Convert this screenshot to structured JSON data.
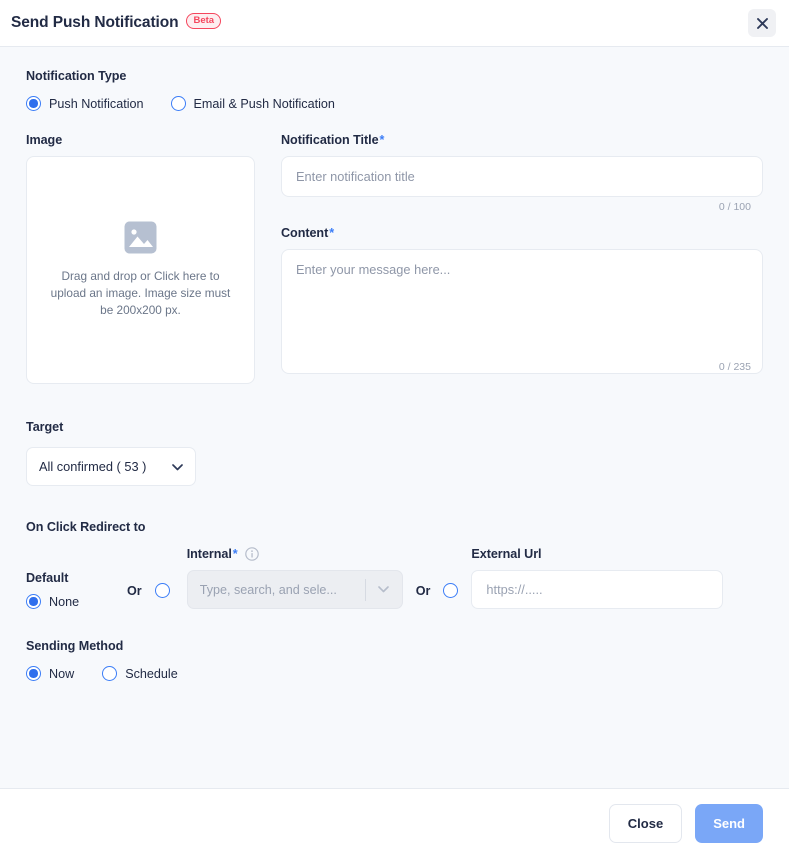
{
  "header": {
    "title": "Send Push Notification",
    "badge": "Beta",
    "close_icon": "close-icon"
  },
  "notification_type": {
    "label": "Notification Type",
    "options": [
      {
        "label": "Push Notification",
        "checked": true
      },
      {
        "label": "Email & Push Notification",
        "checked": false
      }
    ]
  },
  "image": {
    "label": "Image",
    "dropzone_text": "Drag and drop or Click here to upload an image. Image size must be 200x200 px.",
    "icon": "image-placeholder-icon"
  },
  "title_field": {
    "label": "Notification Title",
    "required_mark": "*",
    "placeholder": "Enter notification title",
    "value": "",
    "counter": "0 / 100"
  },
  "content_field": {
    "label": "Content",
    "required_mark": "*",
    "placeholder": "Enter your message here...",
    "value": "",
    "counter": "0 / 235"
  },
  "target": {
    "label": "Target",
    "selected": "All confirmed ( 53 )",
    "options": [
      "All confirmed ( 53 )"
    ]
  },
  "redirect": {
    "section_label": "On Click Redirect to",
    "default_label": "Default",
    "none_label": "None",
    "none_checked": true,
    "or_1": "Or",
    "internal_radio_checked": false,
    "internal_label": "Internal",
    "internal_required_mark": "*",
    "internal_info_icon": "info-icon",
    "internal_placeholder": "Type, search, and sele...",
    "internal_disabled": true,
    "or_2": "Or",
    "external_radio_checked": false,
    "external_label": "External Url",
    "external_placeholder": "https://.....",
    "external_value": ""
  },
  "sending_method": {
    "label": "Sending Method",
    "options": [
      {
        "label": "Now",
        "checked": true
      },
      {
        "label": "Schedule",
        "checked": false
      }
    ]
  },
  "footer": {
    "close_label": "Close",
    "send_label": "Send",
    "send_disabled": true
  },
  "colors": {
    "accent": "#2f6fed",
    "badge": "#f5465d",
    "text": "#222b45",
    "muted": "#8f97a8",
    "page_bg": "#f7f9fc",
    "send_button": "#7aa7f7"
  }
}
